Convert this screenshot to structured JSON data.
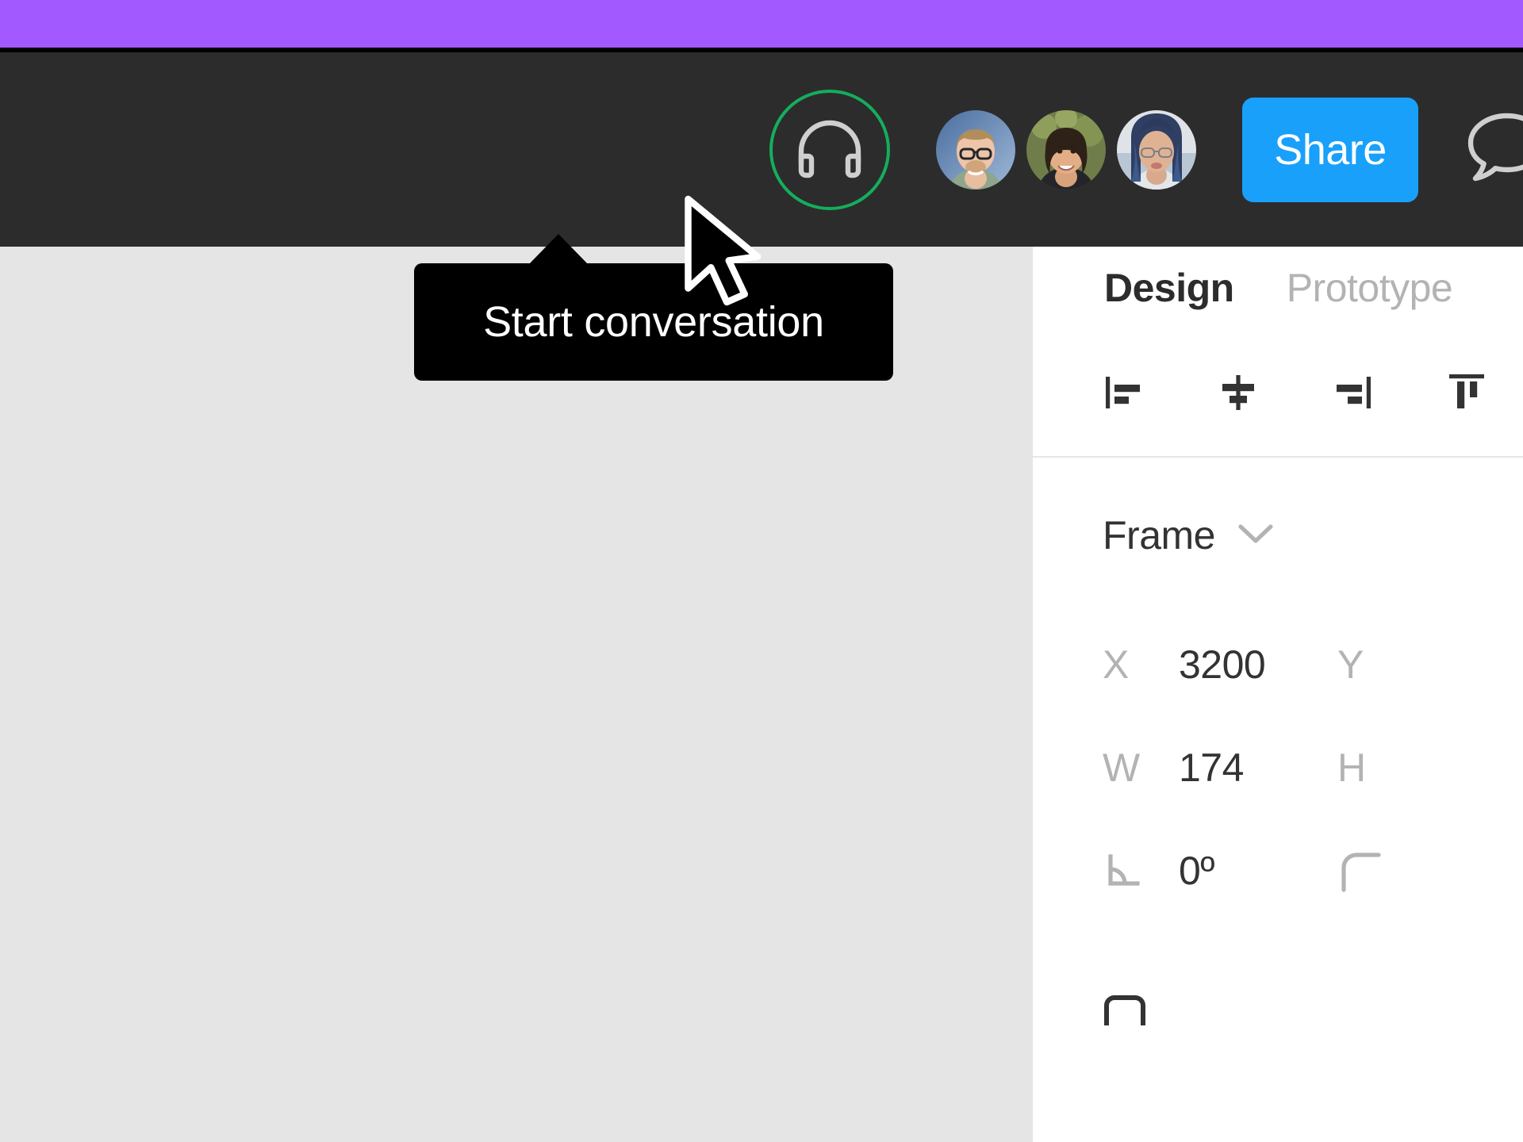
{
  "theme": {
    "purple_accent": "#a259ff",
    "toolbar_bg": "#2c2c2c",
    "canvas_bg": "#e5e5e5",
    "panel_bg": "#ffffff",
    "share_button_bg": "#18a0fb",
    "active_ring": "#14ae5c",
    "tooltip_bg": "#000000",
    "label_gray": "#b3b3b3",
    "text_dark": "#333333"
  },
  "toolbar": {
    "observation_mode_icon": "headphones-icon",
    "collaborators": [
      {
        "name": "collaborator-1",
        "alt": "man with glasses and beard"
      },
      {
        "name": "collaborator-2",
        "alt": "smiling woman outdoors"
      },
      {
        "name": "collaborator-3",
        "alt": "woman with blue hair and glasses"
      }
    ],
    "share_label": "Share",
    "comment_icon": "comment-bubble-icon"
  },
  "tooltip": {
    "text": "Start conversation"
  },
  "cursor": {
    "icon": "arrow-pointer-icon"
  },
  "panel": {
    "tabs": [
      {
        "label": "Design",
        "active": true
      },
      {
        "label": "Prototype",
        "active": false
      }
    ],
    "align_buttons": [
      {
        "name": "align-left-icon",
        "label": "Align left"
      },
      {
        "name": "align-horizontal-center-icon",
        "label": "Align horizontal centers"
      },
      {
        "name": "align-right-icon",
        "label": "Align right"
      },
      {
        "name": "align-top-icon",
        "label": "Align top"
      }
    ],
    "section": {
      "title": "Frame",
      "chevron": "chevron-down-icon"
    },
    "properties": {
      "x_label": "X",
      "x_value": "3200",
      "y_label": "Y",
      "w_label": "W",
      "w_value": "174",
      "h_label": "H",
      "rotation_icon": "rotation-angle-icon",
      "rotation_value": "0º",
      "corner_radius_icon": "corner-radius-icon",
      "clip_content_icon": "clip-content-icon"
    }
  }
}
